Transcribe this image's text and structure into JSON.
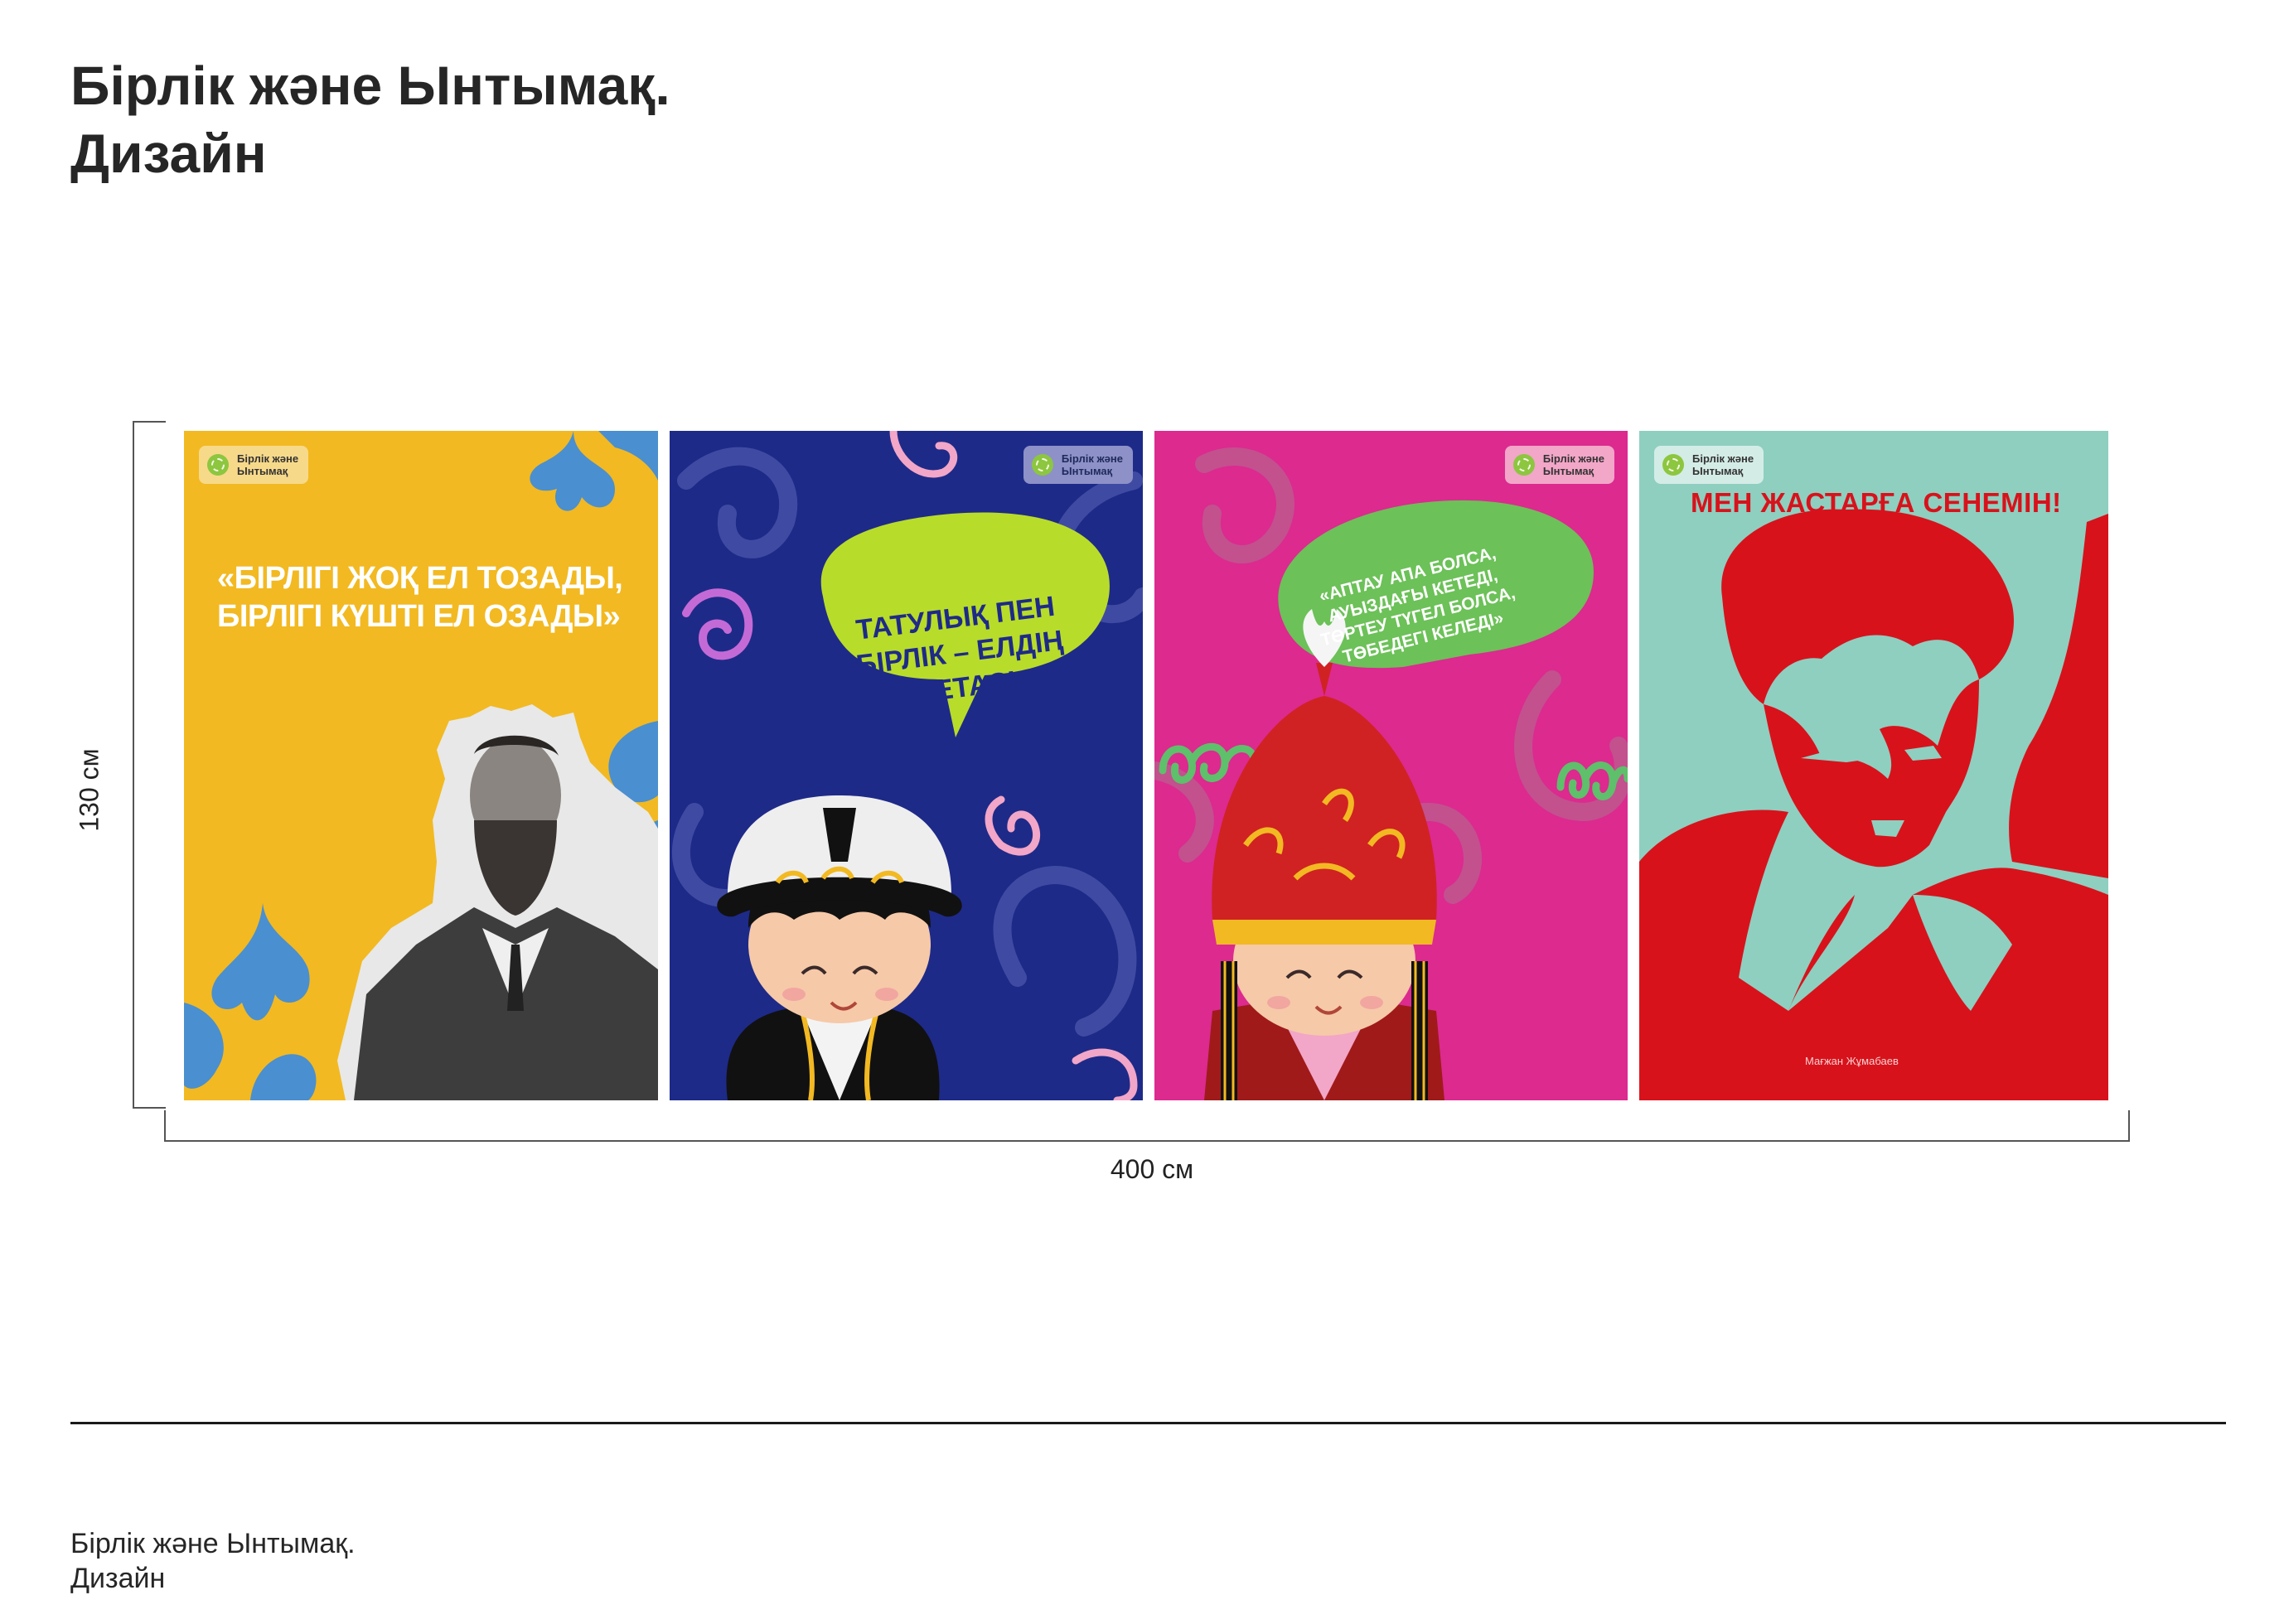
{
  "header": {
    "title_line1": "Бірлік және Ынтымақ.",
    "title_line2": "Дизайн"
  },
  "dimensions": {
    "height_label": "130 см",
    "width_label": "400 см"
  },
  "logo": {
    "line1": "Бірлік және",
    "line2": "Ынтымақ"
  },
  "posters": [
    {
      "quote_line1": "«БІРЛІГІ  ЖОҚ ЕЛ ТОЗАДЫ,",
      "quote_line2": "БІРЛІГІ КҮШТІ ЕЛ ОЗАДЫ»",
      "background": "#f2b922",
      "accent": "#4a8fd0"
    },
    {
      "bubble_line1": "ТАТУЛЫҚ ПЕН",
      "bubble_line2": "БІРЛІК – ЕЛДІҢ",
      "bubble_line3": "ІРГЕТАСЫ",
      "background": "#1e2a88",
      "bubble_color": "#b8dc2a"
    },
    {
      "bubble_line1": "«АПТАУ АПА БОЛСА,",
      "bubble_line2": "АУЫЗДАҒЫ КЕТЕДІ,",
      "bubble_line3": "ТӨРТЕУ ТҮГЕЛ БОЛСА,",
      "bubble_line4": "ТӨБЕДЕГІ КЕЛЕДІ»",
      "background": "#dc2a8f",
      "bubble_color": "#6cc158"
    },
    {
      "headline": "МЕН ЖАСТАРҒА СЕНЕМІН!",
      "caption": "Мағжан Жұмабаев",
      "background": "#8ecfc0",
      "figure_color": "#d8121b"
    }
  ],
  "footer": {
    "line1": "Бірлік және Ынтымақ.",
    "line2": "Дизайн"
  }
}
